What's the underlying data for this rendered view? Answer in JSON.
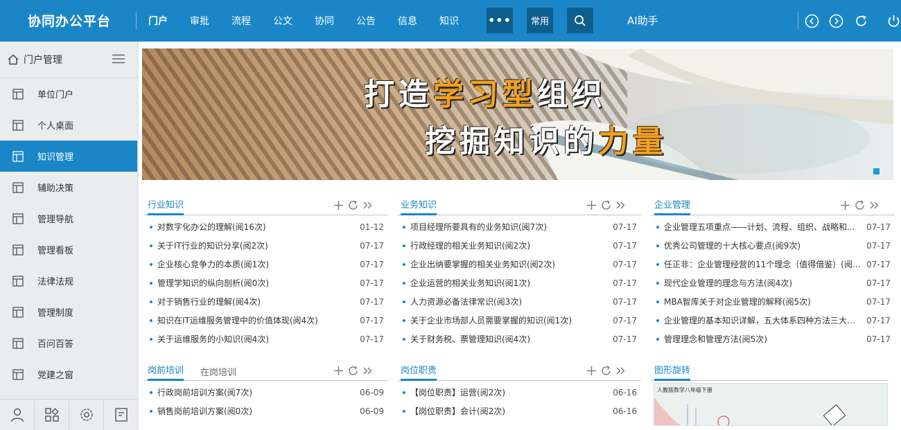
{
  "brand": "协同办公平台",
  "nav": [
    "门户",
    "审批",
    "流程",
    "公文",
    "协同",
    "公告",
    "信息",
    "知识"
  ],
  "more_label": "•••",
  "common_label": "常用",
  "ai_label": "AI助手",
  "colors": {
    "primary": "#1a86c8",
    "dark_box": "#0f5f8e",
    "accent_orange": "#f4a11c"
  },
  "icons": [
    "search-icon",
    "back-icon",
    "forward-icon",
    "refresh-icon",
    "power-icon",
    "home-icon",
    "menu-icon",
    "layout-icon",
    "user-icon",
    "apps-icon",
    "settings-icon",
    "note-icon",
    "plus-icon",
    "refresh-small-icon",
    "more-arrows-icon"
  ],
  "sidebar": {
    "header": "门户管理",
    "items": [
      "单位门户",
      "个人桌面",
      "知识管理",
      "辅助决策",
      "管理导航",
      "管理看板",
      "法律法规",
      "管理制度",
      "百问百答",
      "党建之窗"
    ],
    "active_index": 2
  },
  "banner": {
    "line1": [
      "打造",
      "学习型",
      "组织"
    ],
    "line2": [
      "挖掘知识的",
      "力量"
    ]
  },
  "panels": [
    {
      "tabs": [
        "行业知识"
      ],
      "rows": [
        {
          "title": "对数字化办公的理解(阅16次)",
          "date": "01-12"
        },
        {
          "title": "关于IT行业的知识分享(阅2次)",
          "date": "07-17"
        },
        {
          "title": "企业核心竞争力的本质(阅1次)",
          "date": "07-17"
        },
        {
          "title": "管理学知识的纵向剖析(阅0次)",
          "date": "07-17"
        },
        {
          "title": "对于销售行业的理解(阅4次)",
          "date": "07-17"
        },
        {
          "title": "知识在IT运维服务管理中的价值体现(阅4次)",
          "date": "07-17"
        },
        {
          "title": "关于运维服务的小知识(阅4次)",
          "date": "07-17"
        }
      ]
    },
    {
      "tabs": [
        "业务知识"
      ],
      "rows": [
        {
          "title": "项目经理所要具有的业务知识(阅7次)",
          "date": "07-17"
        },
        {
          "title": "行政经理的相关业务知识(阅2次)",
          "date": "07-17"
        },
        {
          "title": "企业出纳要掌握的相关业务知识(阅2次)",
          "date": "07-17"
        },
        {
          "title": "企业运营的相关业务知识(阅1次)",
          "date": "07-17"
        },
        {
          "title": "人力资源必备法律常识(阅3次)",
          "date": "07-17"
        },
        {
          "title": "关于企业市场部人员需要掌握的知识(阅1次)",
          "date": "07-17"
        },
        {
          "title": "关于财务税、票管理知识(阅4次)",
          "date": "07-17"
        }
      ]
    },
    {
      "tabs": [
        "企业管理"
      ],
      "rows": [
        {
          "title": "企业管理五项重点——计划、流程、组织、战略和...",
          "date": "07-17"
        },
        {
          "title": "优秀公司管理的十大核心要点(阅9次)",
          "date": "07-17"
        },
        {
          "title": "任正非：企业管理经营的11个理念（值得借鉴）(阅...",
          "date": "07-17"
        },
        {
          "title": "现代企业管理的理念与方法(阅4次)",
          "date": "07-17"
        },
        {
          "title": "MBA智库关于对企业管理的解释(阅5次)",
          "date": "07-17"
        },
        {
          "title": "企业管理的基本知识详解，五大体系四种方法三大核...",
          "date": "07-17"
        },
        {
          "title": "管理理念和管理方法(阅5次)",
          "date": "07-17"
        }
      ]
    },
    {
      "tabs": [
        "岗前培训",
        "在岗培训"
      ],
      "rows": [
        {
          "title": "行政岗前培训方案(阅7次)",
          "date": "06-09"
        },
        {
          "title": "销售岗前培训方案(阅0次)",
          "date": "06-09"
        }
      ]
    },
    {
      "tabs": [
        "岗位职责"
      ],
      "rows": [
        {
          "title": "【岗位职责】运营(阅2次)",
          "date": "06-16"
        },
        {
          "title": "【岗位职责】会计(阅2次)",
          "date": "06-16"
        }
      ]
    },
    {
      "tabs": [
        "图形旋转"
      ],
      "rows": []
    }
  ],
  "rotation_image_caption": "人教版数学八年级下册"
}
